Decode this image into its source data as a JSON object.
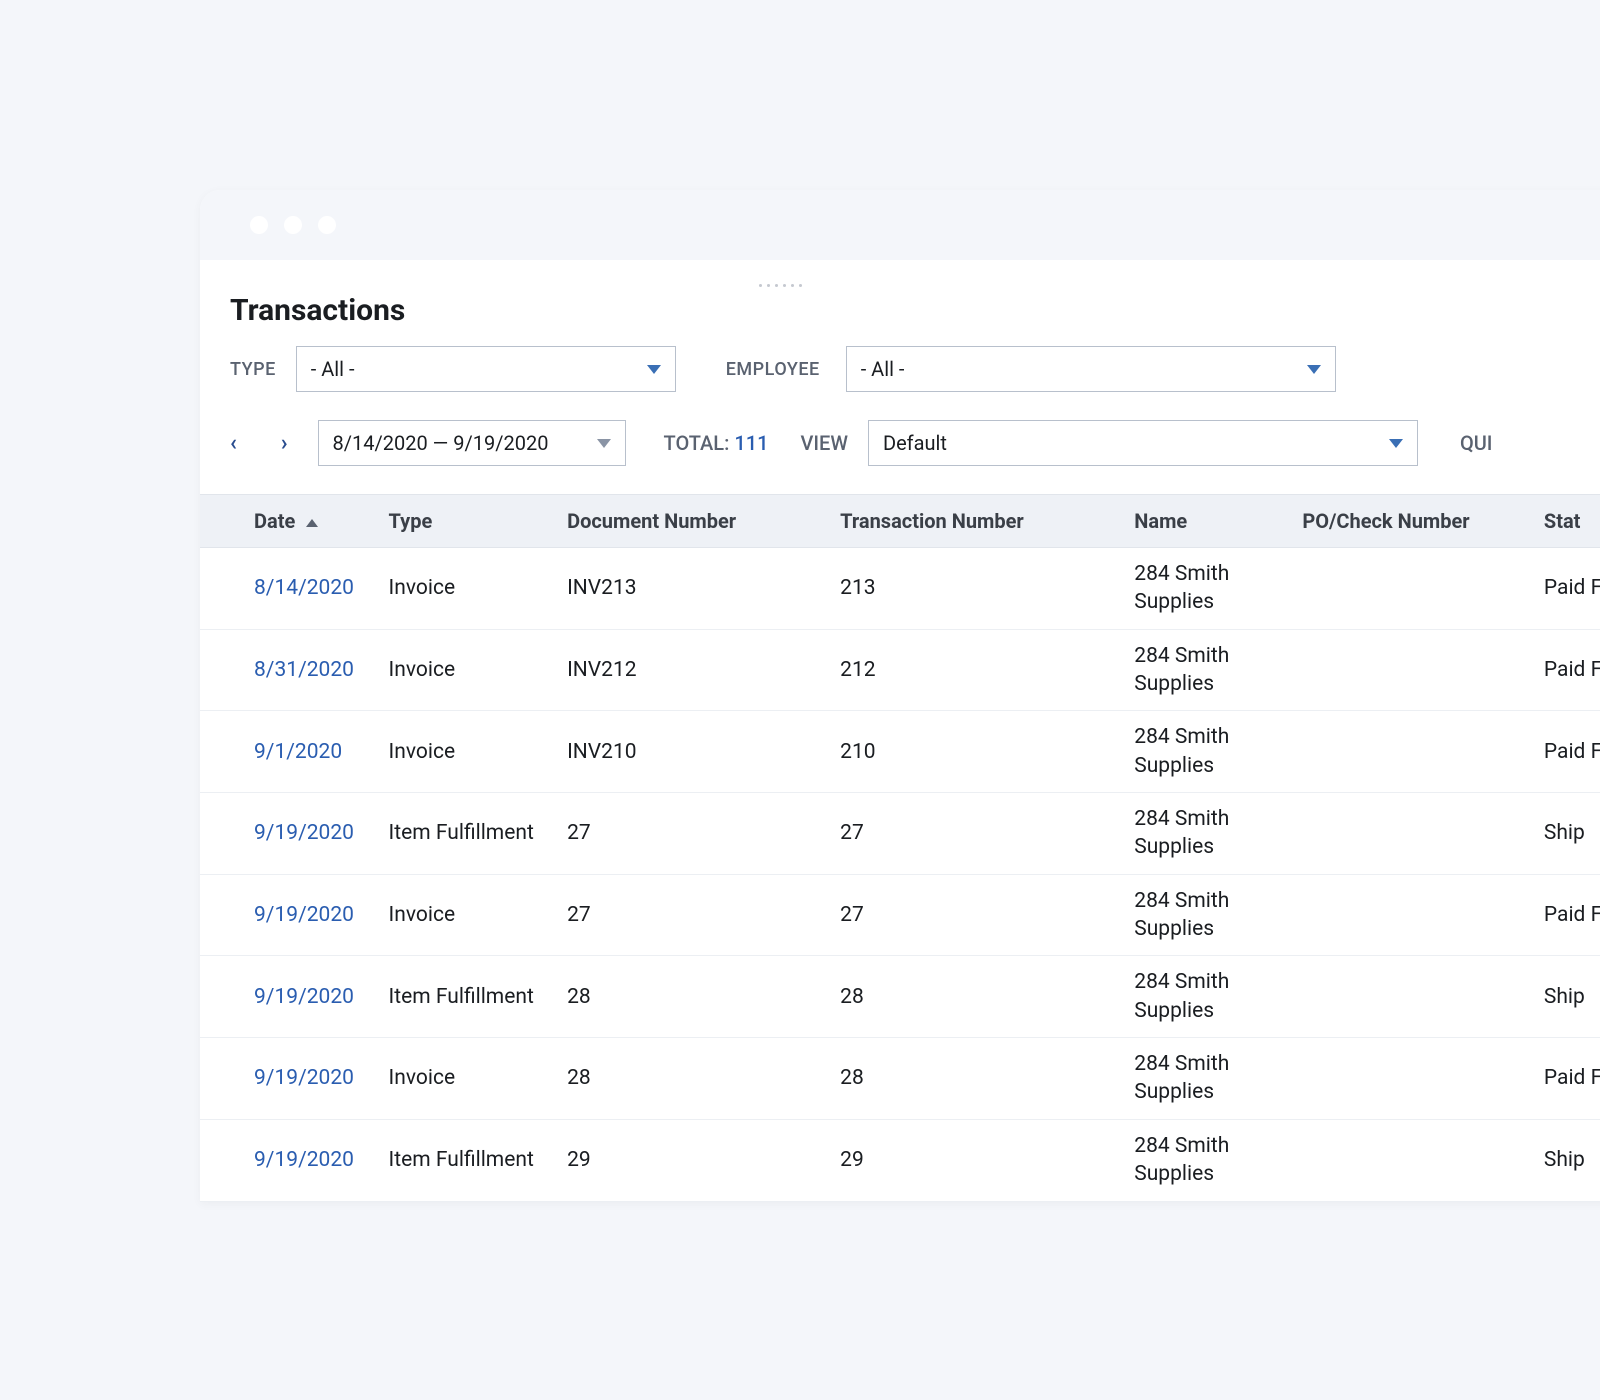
{
  "pageTitle": "Transactions",
  "filters": {
    "typeLabel": "TYPE",
    "typeValue": "- All -",
    "employeeLabel": "EMPLOYEE",
    "employeeValue": "- All -",
    "dateRange": "8/14/2020 — 9/19/2020",
    "totalLabel": "TOTAL:",
    "totalValue": "111",
    "viewLabel": "VIEW",
    "viewValue": "Default",
    "quickLabel": "QUI"
  },
  "columns": {
    "date": "Date",
    "type": "Type",
    "docNum": "Document Number",
    "txnNum": "Transaction Number",
    "name": "Name",
    "po": "PO/Check Number",
    "status": "Stat"
  },
  "rows": [
    {
      "date": "8/14/2020",
      "type": "Invoice",
      "doc": "INV213",
      "txn": "213",
      "name": "284 Smith Supplies",
      "po": "",
      "status": "Paid Full"
    },
    {
      "date": "8/31/2020",
      "type": "Invoice",
      "doc": "INV212",
      "txn": "212",
      "name": "284 Smith Supplies",
      "po": "",
      "status": "Paid Full"
    },
    {
      "date": "9/1/2020",
      "type": "Invoice",
      "doc": "INV210",
      "txn": "210",
      "name": "284 Smith Supplies",
      "po": "",
      "status": "Paid Full"
    },
    {
      "date": "9/19/2020",
      "type": "Item Fulfillment",
      "doc": "27",
      "txn": "27",
      "name": "284 Smith Supplies",
      "po": "",
      "status": "Ship"
    },
    {
      "date": "9/19/2020",
      "type": "Invoice",
      "doc": "27",
      "txn": "27",
      "name": "284 Smith Supplies",
      "po": "",
      "status": "Paid Full"
    },
    {
      "date": "9/19/2020",
      "type": "Item Fulfillment",
      "doc": "28",
      "txn": "28",
      "name": "284 Smith Supplies",
      "po": "",
      "status": "Ship"
    },
    {
      "date": "9/19/2020",
      "type": "Invoice",
      "doc": "28",
      "txn": "28",
      "name": "284 Smith Supplies",
      "po": "",
      "status": "Paid Full"
    },
    {
      "date": "9/19/2020",
      "type": "Item Fulfillment",
      "doc": "29",
      "txn": "29",
      "name": "284 Smith Supplies",
      "po": "",
      "status": "Ship"
    }
  ]
}
